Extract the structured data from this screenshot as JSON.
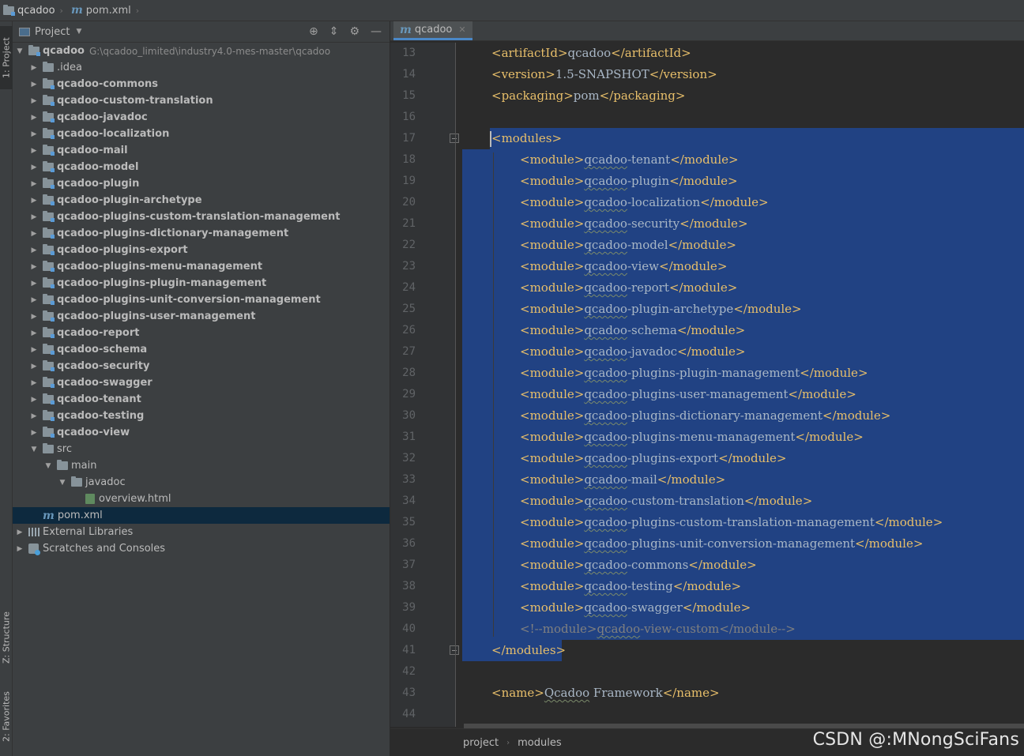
{
  "navbar": {
    "project": "qcadoo",
    "file": "pom.xml"
  },
  "stripe": {
    "project_tab": "1: Project",
    "structure_tab": "Z: Structure",
    "favorites_tab": "2: Favorites"
  },
  "panel": {
    "title": "Project",
    "tools": [
      "target-icon",
      "collapse-icon",
      "gear-icon",
      "minimize-icon"
    ],
    "root": {
      "name": "qcadoo",
      "path": "G:\\qcadoo_limited\\industry4.0-mes-master\\qcadoo"
    },
    "modules": [
      ".idea",
      "qcadoo-commons",
      "qcadoo-custom-translation",
      "qcadoo-javadoc",
      "qcadoo-localization",
      "qcadoo-mail",
      "qcadoo-model",
      "qcadoo-plugin",
      "qcadoo-plugin-archetype",
      "qcadoo-plugins-custom-translation-management",
      "qcadoo-plugins-dictionary-management",
      "qcadoo-plugins-export",
      "qcadoo-plugins-menu-management",
      "qcadoo-plugins-plugin-management",
      "qcadoo-plugins-unit-conversion-management",
      "qcadoo-plugins-user-management",
      "qcadoo-report",
      "qcadoo-schema",
      "qcadoo-security",
      "qcadoo-swagger",
      "qcadoo-tenant",
      "qcadoo-testing",
      "qcadoo-view"
    ],
    "src": "src",
    "main": "main",
    "javadoc": "javadoc",
    "overview": "overview.html",
    "pom": "pom.xml",
    "external": "External Libraries",
    "scratches": "Scratches and Consoles"
  },
  "editor": {
    "tab": "qcadoo",
    "line_numbers": [
      "13",
      "14",
      "15",
      "16",
      "17",
      "18",
      "19",
      "20",
      "21",
      "22",
      "23",
      "24",
      "25",
      "26",
      "27",
      "28",
      "29",
      "30",
      "31",
      "32",
      "33",
      "34",
      "35",
      "36",
      "37",
      "38",
      "39",
      "40",
      "41",
      "42",
      "43",
      "44"
    ],
    "lines": [
      {
        "indent": 1,
        "parts": [
          [
            "tag",
            "<artifactId>"
          ],
          [
            "txt",
            "qcadoo"
          ],
          [
            "tag",
            "</artifactId>"
          ]
        ]
      },
      {
        "indent": 1,
        "parts": [
          [
            "tag",
            "<version>"
          ],
          [
            "txt",
            "1.5-SNAPSHOT"
          ],
          [
            "tag",
            "</version>"
          ]
        ]
      },
      {
        "indent": 1,
        "parts": [
          [
            "tag",
            "<packaging>"
          ],
          [
            "txt",
            "pom"
          ],
          [
            "tag",
            "</packaging>"
          ]
        ]
      },
      {
        "indent": 0,
        "parts": []
      },
      {
        "indent": 1,
        "parts": [
          [
            "tag",
            "<modules>"
          ]
        ]
      },
      {
        "indent": 2,
        "parts": [
          [
            "tag",
            "<module>"
          ],
          [
            "sq",
            "qcadoo"
          ],
          [
            "txt",
            "-tenant"
          ],
          [
            "tag",
            "</module>"
          ]
        ]
      },
      {
        "indent": 2,
        "parts": [
          [
            "tag",
            "<module>"
          ],
          [
            "sq",
            "qcadoo"
          ],
          [
            "txt",
            "-plugin"
          ],
          [
            "tag",
            "</module>"
          ]
        ]
      },
      {
        "indent": 2,
        "parts": [
          [
            "tag",
            "<module>"
          ],
          [
            "sq",
            "qcadoo"
          ],
          [
            "txt",
            "-localization"
          ],
          [
            "tag",
            "</module>"
          ]
        ]
      },
      {
        "indent": 2,
        "parts": [
          [
            "tag",
            "<module>"
          ],
          [
            "sq",
            "qcadoo"
          ],
          [
            "txt",
            "-security"
          ],
          [
            "tag",
            "</module>"
          ]
        ]
      },
      {
        "indent": 2,
        "parts": [
          [
            "tag",
            "<module>"
          ],
          [
            "sq",
            "qcadoo"
          ],
          [
            "txt",
            "-model"
          ],
          [
            "tag",
            "</module>"
          ]
        ]
      },
      {
        "indent": 2,
        "parts": [
          [
            "tag",
            "<module>"
          ],
          [
            "sq",
            "qcadoo"
          ],
          [
            "txt",
            "-view"
          ],
          [
            "tag",
            "</module>"
          ]
        ]
      },
      {
        "indent": 2,
        "parts": [
          [
            "tag",
            "<module>"
          ],
          [
            "sq",
            "qcadoo"
          ],
          [
            "txt",
            "-report"
          ],
          [
            "tag",
            "</module>"
          ]
        ]
      },
      {
        "indent": 2,
        "parts": [
          [
            "tag",
            "<module>"
          ],
          [
            "sq",
            "qcadoo"
          ],
          [
            "txt",
            "-plugin-archetype"
          ],
          [
            "tag",
            "</module>"
          ]
        ]
      },
      {
        "indent": 2,
        "parts": [
          [
            "tag",
            "<module>"
          ],
          [
            "sq",
            "qcadoo"
          ],
          [
            "txt",
            "-schema"
          ],
          [
            "tag",
            "</module>"
          ]
        ]
      },
      {
        "indent": 2,
        "parts": [
          [
            "tag",
            "<module>"
          ],
          [
            "sq",
            "qcadoo"
          ],
          [
            "txt",
            "-javadoc"
          ],
          [
            "tag",
            "</module>"
          ]
        ]
      },
      {
        "indent": 2,
        "parts": [
          [
            "tag",
            "<module>"
          ],
          [
            "sq",
            "qcadoo"
          ],
          [
            "txt",
            "-plugins-plugin-management"
          ],
          [
            "tag",
            "</module>"
          ]
        ]
      },
      {
        "indent": 2,
        "parts": [
          [
            "tag",
            "<module>"
          ],
          [
            "sq",
            "qcadoo"
          ],
          [
            "txt",
            "-plugins-user-management"
          ],
          [
            "tag",
            "</module>"
          ]
        ]
      },
      {
        "indent": 2,
        "parts": [
          [
            "tag",
            "<module>"
          ],
          [
            "sq",
            "qcadoo"
          ],
          [
            "txt",
            "-plugins-dictionary-management"
          ],
          [
            "tag",
            "</module>"
          ]
        ]
      },
      {
        "indent": 2,
        "parts": [
          [
            "tag",
            "<module>"
          ],
          [
            "sq",
            "qcadoo"
          ],
          [
            "txt",
            "-plugins-menu-management"
          ],
          [
            "tag",
            "</module>"
          ]
        ]
      },
      {
        "indent": 2,
        "parts": [
          [
            "tag",
            "<module>"
          ],
          [
            "sq",
            "qcadoo"
          ],
          [
            "txt",
            "-plugins-export"
          ],
          [
            "tag",
            "</module>"
          ]
        ]
      },
      {
        "indent": 2,
        "parts": [
          [
            "tag",
            "<module>"
          ],
          [
            "sq",
            "qcadoo"
          ],
          [
            "txt",
            "-mail"
          ],
          [
            "tag",
            "</module>"
          ]
        ]
      },
      {
        "indent": 2,
        "parts": [
          [
            "tag",
            "<module>"
          ],
          [
            "sq",
            "qcadoo"
          ],
          [
            "txt",
            "-custom-translation"
          ],
          [
            "tag",
            "</module>"
          ]
        ]
      },
      {
        "indent": 2,
        "parts": [
          [
            "tag",
            "<module>"
          ],
          [
            "sq",
            "qcadoo"
          ],
          [
            "txt",
            "-plugins-custom-translation-management"
          ],
          [
            "tag",
            "</module>"
          ]
        ]
      },
      {
        "indent": 2,
        "parts": [
          [
            "tag",
            "<module>"
          ],
          [
            "sq",
            "qcadoo"
          ],
          [
            "txt",
            "-plugins-unit-conversion-management"
          ],
          [
            "tag",
            "</module>"
          ]
        ]
      },
      {
        "indent": 2,
        "parts": [
          [
            "tag",
            "<module>"
          ],
          [
            "sq",
            "qcadoo"
          ],
          [
            "txt",
            "-commons"
          ],
          [
            "tag",
            "</module>"
          ]
        ]
      },
      {
        "indent": 2,
        "parts": [
          [
            "tag",
            "<module>"
          ],
          [
            "sq",
            "qcadoo"
          ],
          [
            "txt",
            "-testing"
          ],
          [
            "tag",
            "</module>"
          ]
        ]
      },
      {
        "indent": 2,
        "parts": [
          [
            "tag",
            "<module>"
          ],
          [
            "sq",
            "qcadoo"
          ],
          [
            "txt",
            "-swagger"
          ],
          [
            "tag",
            "</module>"
          ]
        ]
      },
      {
        "indent": 2,
        "parts": [
          [
            "cmt",
            "<!--module>"
          ],
          [
            "csq",
            "qcadoo"
          ],
          [
            "cmt",
            "-view-custom</module-->"
          ]
        ]
      },
      {
        "indent": 1,
        "parts": [
          [
            "tag",
            "</modules>"
          ]
        ]
      },
      {
        "indent": 0,
        "parts": []
      },
      {
        "indent": 1,
        "parts": [
          [
            "tag",
            "<name>"
          ],
          [
            "sq",
            "Qcadoo"
          ],
          [
            "txt",
            " Framework"
          ],
          [
            "tag",
            "</name>"
          ]
        ]
      },
      {
        "indent": 0,
        "parts": []
      }
    ]
  },
  "breadcrumb": [
    "project",
    "modules"
  ],
  "watermark": "CSDN @:MNongSciFans"
}
